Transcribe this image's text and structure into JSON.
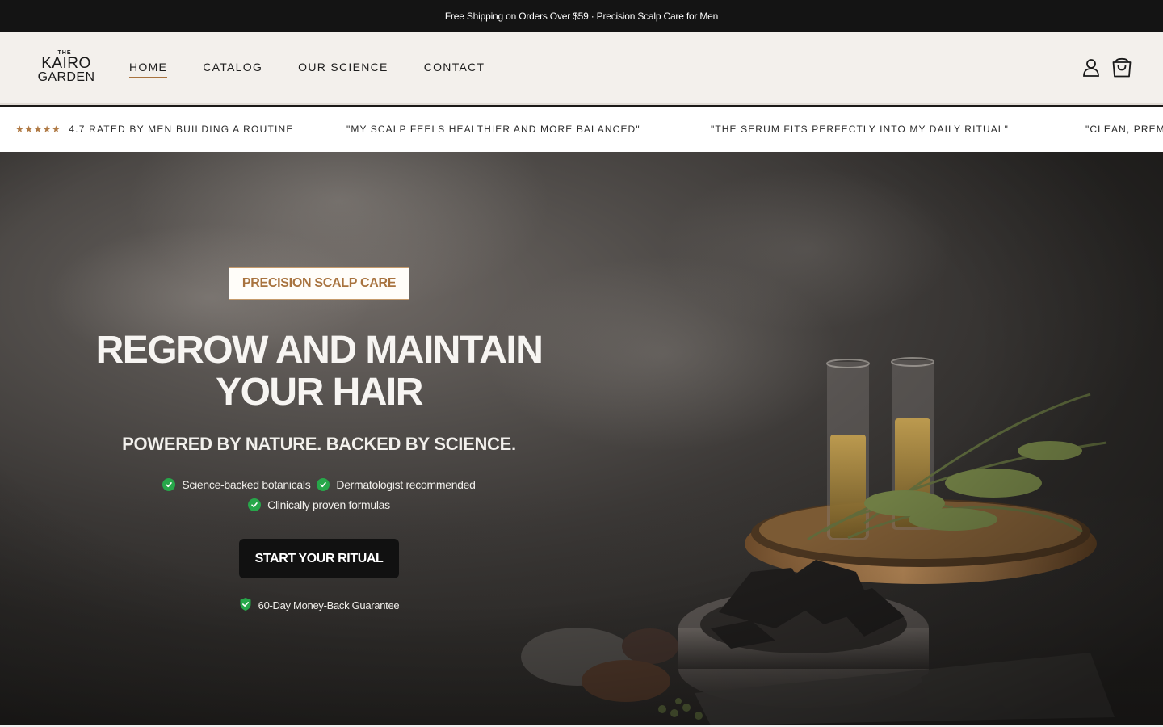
{
  "announcement": {
    "text": "Free Shipping on Orders Over $59 · Precision Scalp Care for Men"
  },
  "header": {
    "logo": {
      "the": "THE",
      "line1": "KAIRO",
      "line2": "GARDEN"
    },
    "nav": [
      {
        "label": "HOME",
        "active": true
      },
      {
        "label": "CATALOG",
        "active": false
      },
      {
        "label": "OUR SCIENCE",
        "active": false
      },
      {
        "label": "CONTACT",
        "active": false
      }
    ],
    "icons": [
      "account-icon",
      "cart-icon"
    ]
  },
  "ticker": {
    "stars": "★★★★★",
    "rating_text": "4.7 RATED BY MEN BUILDING A ROUTINE",
    "quotes": [
      "\"MY SCALP FEELS HEALTHIER AND MORE BALANCED\"",
      "\"THE SERUM FITS PERFECTLY INTO MY DAILY RITUAL\"",
      "\"CLEAN, PREM"
    ]
  },
  "hero": {
    "eyebrow": "PRECISION SCALP CARE",
    "headline_line1": "REGROW AND MAINTAIN",
    "headline_line2": "YOUR HAIR",
    "subhead": "POWERED BY NATURE. BACKED BY SCIENCE.",
    "features": [
      "Science-backed botanicals",
      "Dermatologist recommended",
      "Clinically proven formulas"
    ],
    "cta_label": "START YOUR RITUAL",
    "guarantee": "60-Day Money-Back Guarantee"
  },
  "colors": {
    "accent": "#a8733f",
    "check_green": "#27a74a",
    "announcement_bg": "#141414",
    "header_bg": "#f3f0ec",
    "cta_bg": "#111111"
  }
}
